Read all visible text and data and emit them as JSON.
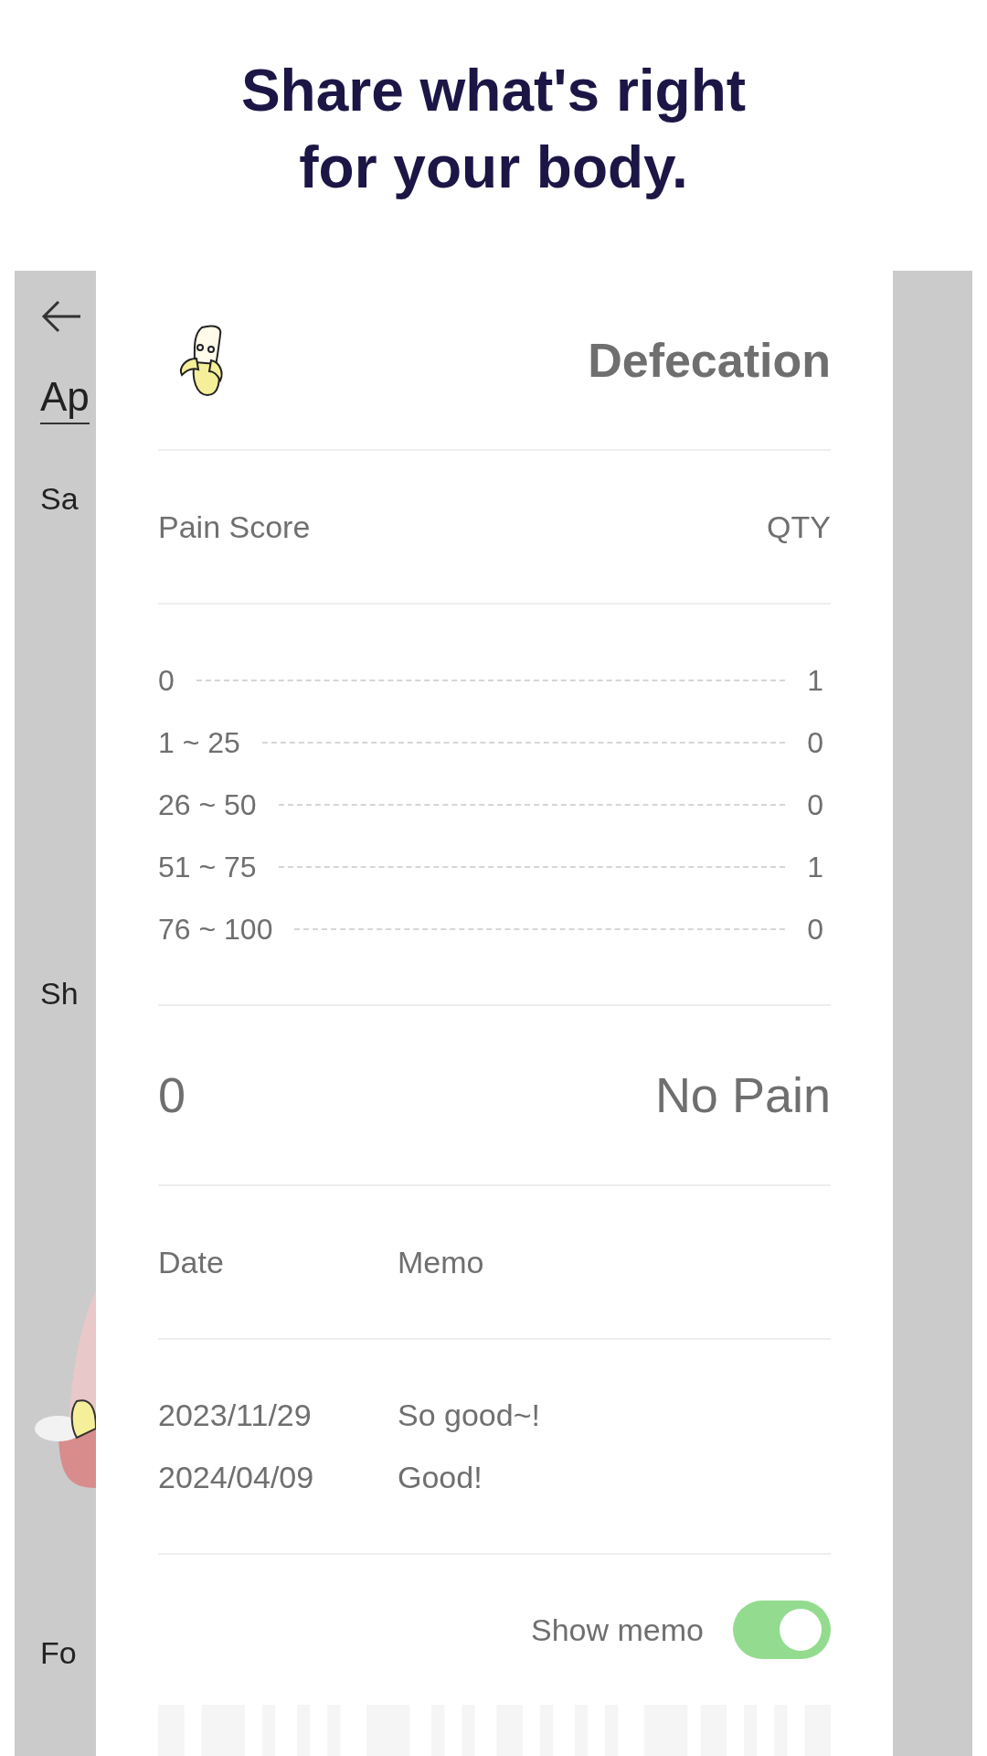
{
  "headline_lines": [
    "Share what's right",
    "for your body."
  ],
  "background": {
    "title": "Ap",
    "labels": [
      "Sa",
      "Sh",
      "Fo"
    ]
  },
  "card": {
    "title": "Defecation",
    "columns": {
      "left": "Pain Score",
      "right": "QTY"
    },
    "pain_ranges": [
      {
        "range": "0",
        "qty": "1"
      },
      {
        "range": "1 ~ 25",
        "qty": "0"
      },
      {
        "range": "26 ~ 50",
        "qty": "0"
      },
      {
        "range": "51 ~ 75",
        "qty": "1"
      },
      {
        "range": "76 ~ 100",
        "qty": "0"
      }
    ],
    "score": {
      "value": "0",
      "label": "No Pain"
    },
    "memo_columns": {
      "date": "Date",
      "memo": "Memo"
    },
    "memos": [
      {
        "date": "2023/11/29",
        "memo": "So good~!"
      },
      {
        "date": "2024/04/09",
        "memo": "Good!"
      }
    ],
    "show_memo": {
      "label": "Show memo",
      "on": true
    }
  }
}
